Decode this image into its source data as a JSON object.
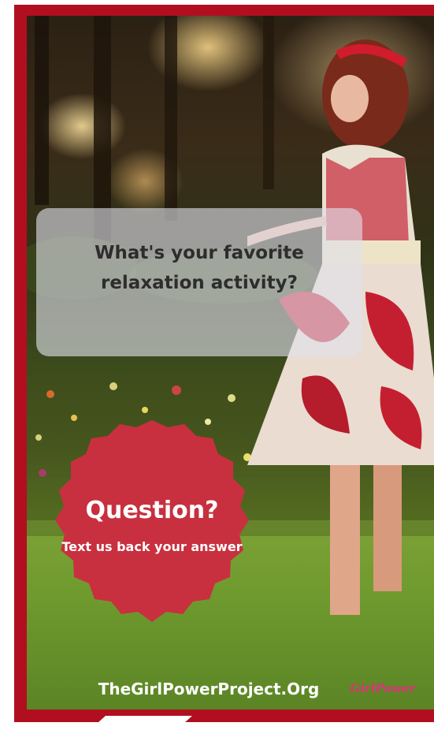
{
  "poster": {
    "question": "What's your favorite relaxation activity?",
    "question_line1": "What's your favorite",
    "question_line2": "relaxation activity?",
    "badge": {
      "title": "Question?",
      "subtitle": "Text us back your answer"
    },
    "footer_url": "TheGirlPowerProject.Org",
    "brand_logo": "GirlPower",
    "colors": {
      "frame": "#b10f1f",
      "badge": "#c8303f",
      "bubble": "rgba(225,225,235,0.62)"
    }
  }
}
